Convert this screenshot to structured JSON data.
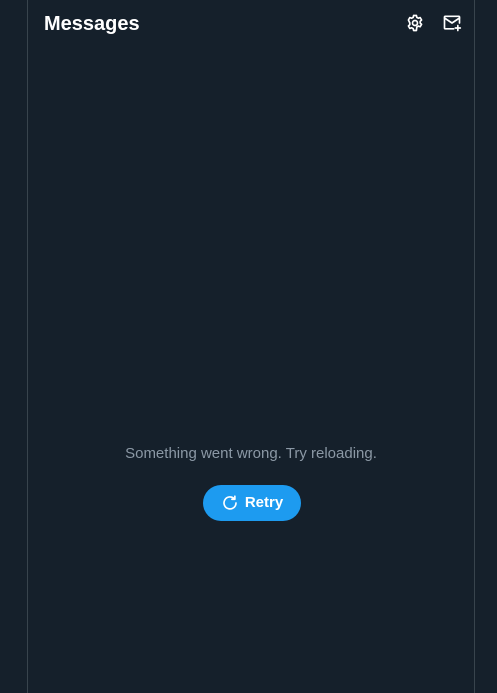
{
  "header": {
    "title": "Messages",
    "settings_icon": "gear-icon",
    "compose_icon": "new-message-icon"
  },
  "error": {
    "message": "Something went wrong. Try reloading.",
    "retry_label": "Retry",
    "retry_icon": "refresh-icon"
  },
  "colors": {
    "background": "#15202b",
    "border": "#38444d",
    "accent": "#1d9bf0",
    "muted_text": "#8b98a5"
  }
}
